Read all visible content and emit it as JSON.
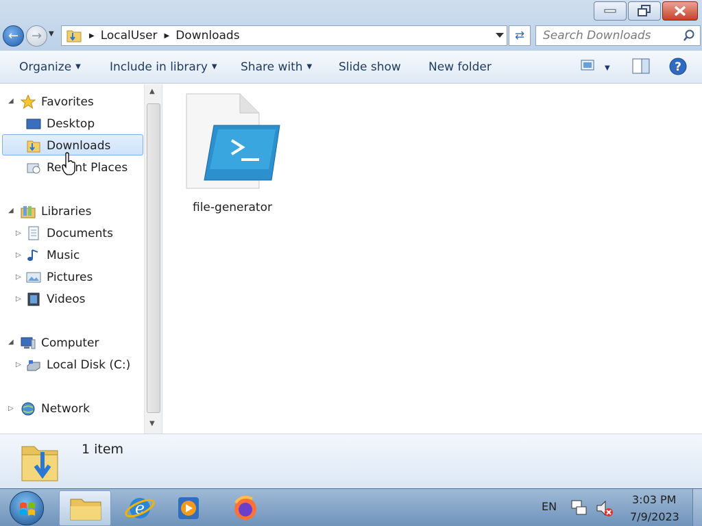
{
  "window": {
    "buttons": [
      "minimize",
      "restore",
      "close"
    ]
  },
  "address": {
    "crumbs": [
      "LocalUser",
      "Downloads"
    ],
    "search_placeholder": "Search Downloads"
  },
  "toolbar": {
    "organize": "Organize",
    "include": "Include in library",
    "share": "Share with",
    "slideshow": "Slide show",
    "newfolder": "New folder"
  },
  "sidebar": {
    "favorites": "Favorites",
    "desktop": "Desktop",
    "downloads": "Downloads",
    "recent": "Recent Places",
    "libraries": "Libraries",
    "documents": "Documents",
    "music": "Music",
    "pictures": "Pictures",
    "videos": "Videos",
    "computer": "Computer",
    "localdisk": "Local Disk (C:)",
    "network": "Network"
  },
  "files": [
    {
      "name": "file-generator",
      "icon": "powershell-script-icon"
    }
  ],
  "details": {
    "count": "1 item"
  },
  "taskbar": {
    "lang": "EN",
    "time": "3:03 PM",
    "date": "7/9/2023"
  },
  "colors": {
    "accent": "#1b5fae",
    "selection": "#cde3fa",
    "close": "#c7412a"
  }
}
